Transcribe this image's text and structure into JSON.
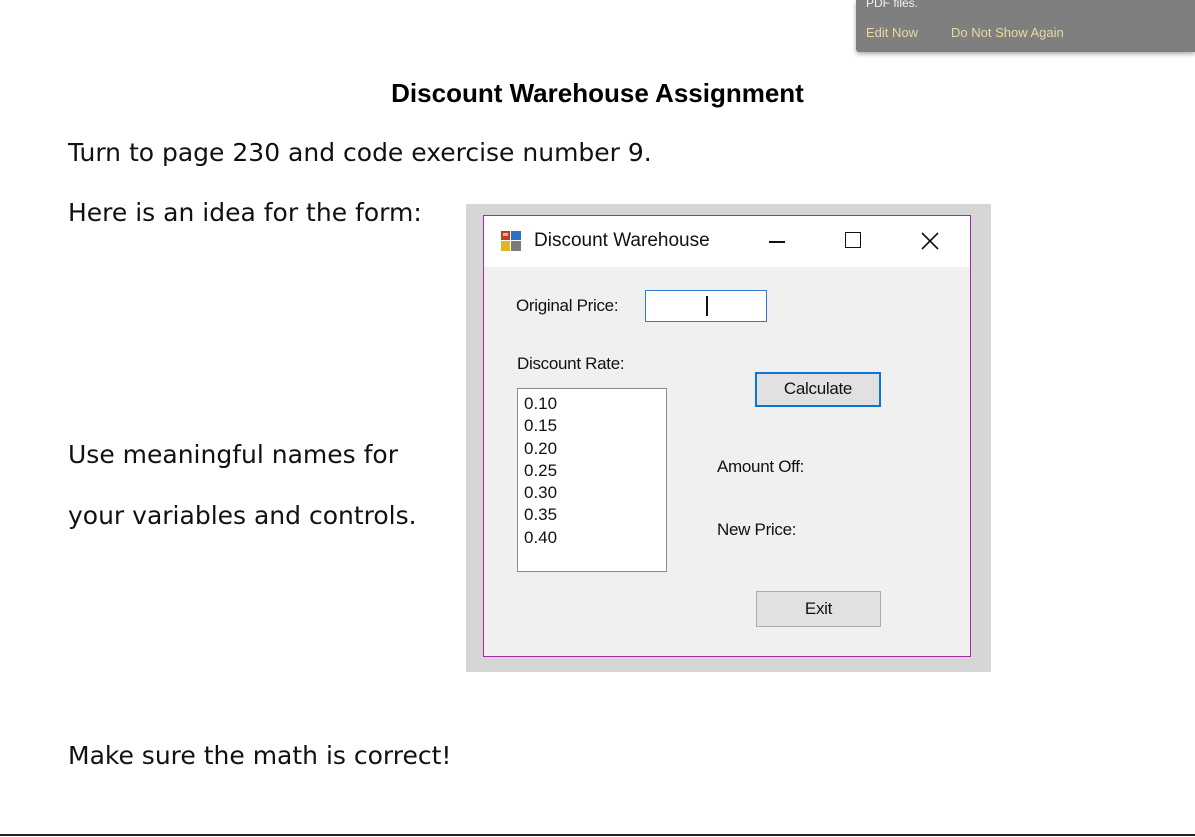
{
  "notification": {
    "text": "PDF files.",
    "edit_now": "Edit Now",
    "do_not_show": "Do Not Show Again"
  },
  "document": {
    "title": "Discount Warehouse Assignment",
    "line1": "Turn to page 230 and code exercise number 9.",
    "line2": "Here is an idea for the form:",
    "line3": "Use meaningful names for",
    "line4": "your variables and controls.",
    "line5": "Make sure the math is correct!"
  },
  "form": {
    "title": "Discount Warehouse",
    "original_price_label": "Original Price:",
    "original_price_value": "",
    "discount_rate_label": "Discount Rate:",
    "discount_rates": [
      "0.10",
      "0.15",
      "0.20",
      "0.25",
      "0.30",
      "0.35",
      "0.40"
    ],
    "calculate_label": "Calculate",
    "amount_off_label": "Amount Off:",
    "new_price_label": "New Price:",
    "exit_label": "Exit"
  },
  "colors": {
    "window_border": "#a12aa6",
    "focus_blue": "#0d74d6",
    "notification_bg": "#7f7f7f",
    "notification_link": "#e8d9a5"
  },
  "icons": [
    "app-icon",
    "minimize-icon",
    "maximize-icon",
    "close-icon"
  ]
}
